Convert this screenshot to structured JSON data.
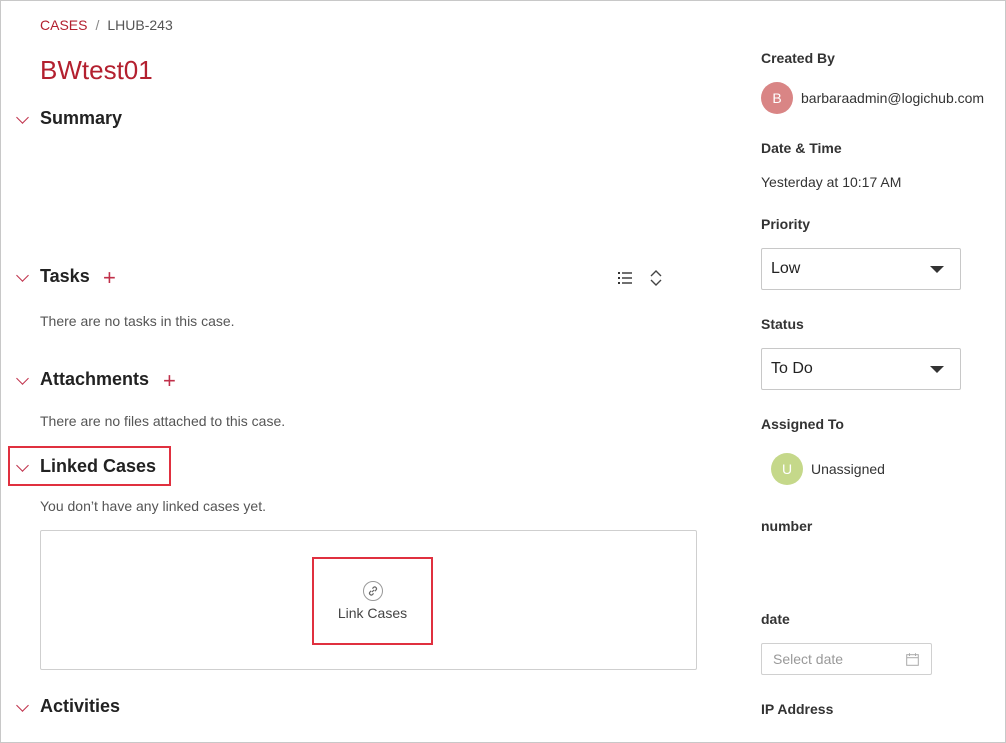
{
  "breadcrumb": {
    "root": "CASES",
    "separator": "/",
    "current": "LHUB-243"
  },
  "case_title": "BWtest01",
  "sections": {
    "summary": {
      "title": "Summary"
    },
    "tasks": {
      "title": "Tasks",
      "empty_text": "There are no tasks in this case."
    },
    "attachments": {
      "title": "Attachments",
      "empty_text": "There are no files attached to this case."
    },
    "linked_cases": {
      "title": "Linked Cases",
      "empty_text": "You don’t have any linked cases yet.",
      "link_button": "Link Cases"
    },
    "activities": {
      "title": "Activities"
    }
  },
  "plus_symbol": "+",
  "sidebar": {
    "created_by": {
      "label": "Created By",
      "avatar_initial": "B",
      "avatar_color": "#d98585",
      "email": "barbaraadmin@logichub.com"
    },
    "date_time": {
      "label": "Date & Time",
      "value": "Yesterday at 10:17 AM"
    },
    "priority": {
      "label": "Priority",
      "value": "Low"
    },
    "status": {
      "label": "Status",
      "value": "To Do"
    },
    "assigned_to": {
      "label": "Assigned To",
      "avatar_initial": "U",
      "avatar_color": "#c5d88a",
      "value": "Unassigned"
    },
    "number": {
      "label": "number"
    },
    "date": {
      "label": "date",
      "placeholder": "Select date"
    },
    "ip_address": {
      "label": "IP Address"
    }
  },
  "colors": {
    "accent": "#b3202f",
    "highlight": "#e0303f"
  }
}
